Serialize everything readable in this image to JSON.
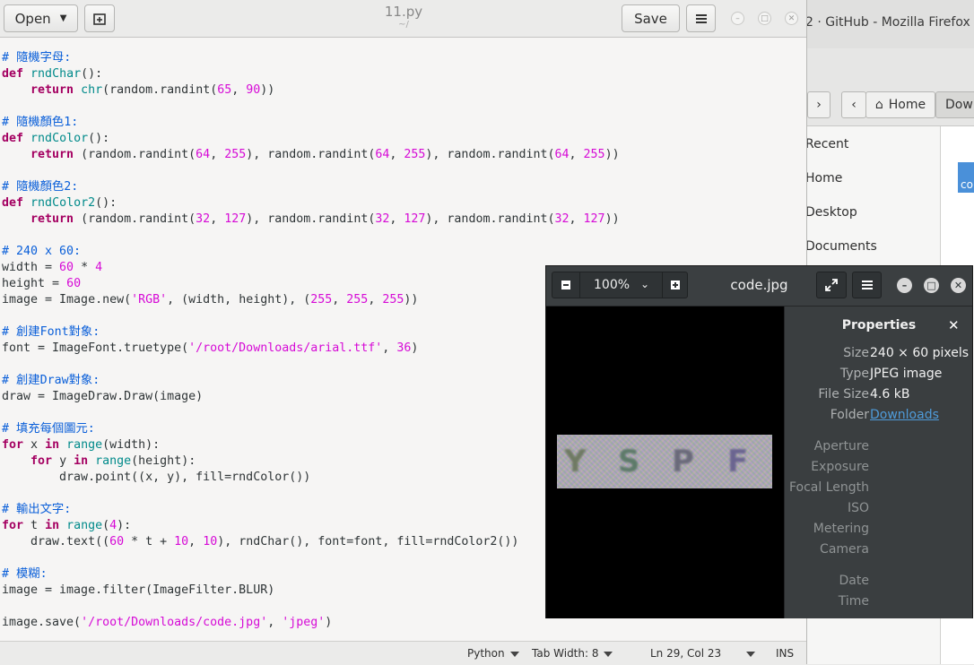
{
  "firefox": {
    "title": "2 · GitHub - Mozilla Firefox"
  },
  "files": {
    "nav_back": "‹",
    "nav_forward": "›",
    "home_label": "Home",
    "current_folder": "Dow",
    "sidebar": [
      "Recent",
      "Home",
      "Desktop",
      "Documents"
    ],
    "file_label": "co"
  },
  "gedit": {
    "open_label": "Open",
    "save_label": "Save",
    "title": "11.py",
    "path": "~/",
    "code": [
      [
        [
          "# 隨機字母:",
          "com"
        ]
      ],
      [
        [
          "def",
          "kw"
        ],
        [
          " ",
          ""
        ],
        [
          "rndChar",
          "fn"
        ],
        [
          "():",
          ""
        ]
      ],
      [
        [
          "    ",
          ""
        ],
        [
          "return",
          "kw"
        ],
        [
          " ",
          ""
        ],
        [
          "chr",
          "fn"
        ],
        [
          "(random.randint(",
          ""
        ],
        [
          "65",
          "num"
        ],
        [
          ", ",
          ""
        ],
        [
          "90",
          "num"
        ],
        [
          "))",
          ""
        ]
      ],
      [],
      [
        [
          "# 隨機顏色1:",
          "com"
        ]
      ],
      [
        [
          "def",
          "kw"
        ],
        [
          " ",
          ""
        ],
        [
          "rndColor",
          "fn"
        ],
        [
          "():",
          ""
        ]
      ],
      [
        [
          "    ",
          ""
        ],
        [
          "return",
          "kw"
        ],
        [
          " (random.randint(",
          ""
        ],
        [
          "64",
          "num"
        ],
        [
          ", ",
          ""
        ],
        [
          "255",
          "num"
        ],
        [
          "), random.randint(",
          ""
        ],
        [
          "64",
          "num"
        ],
        [
          ", ",
          ""
        ],
        [
          "255",
          "num"
        ],
        [
          "), random.randint(",
          ""
        ],
        [
          "64",
          "num"
        ],
        [
          ", ",
          ""
        ],
        [
          "255",
          "num"
        ],
        [
          "))",
          ""
        ]
      ],
      [],
      [
        [
          "# 隨機顏色2:",
          "com"
        ]
      ],
      [
        [
          "def",
          "kw"
        ],
        [
          " ",
          ""
        ],
        [
          "rndColor2",
          "fn"
        ],
        [
          "():",
          ""
        ]
      ],
      [
        [
          "    ",
          ""
        ],
        [
          "return",
          "kw"
        ],
        [
          " (random.randint(",
          ""
        ],
        [
          "32",
          "num"
        ],
        [
          ", ",
          ""
        ],
        [
          "127",
          "num"
        ],
        [
          "), random.randint(",
          ""
        ],
        [
          "32",
          "num"
        ],
        [
          ", ",
          ""
        ],
        [
          "127",
          "num"
        ],
        [
          "), random.randint(",
          ""
        ],
        [
          "32",
          "num"
        ],
        [
          ", ",
          ""
        ],
        [
          "127",
          "num"
        ],
        [
          "))",
          ""
        ]
      ],
      [],
      [
        [
          "# 240 x 60:",
          "com"
        ]
      ],
      [
        [
          "width = ",
          ""
        ],
        [
          "60",
          "num"
        ],
        [
          " * ",
          ""
        ],
        [
          "4",
          "num"
        ]
      ],
      [
        [
          "height = ",
          ""
        ],
        [
          "60",
          "num"
        ]
      ],
      [
        [
          "image = Image.new(",
          ""
        ],
        [
          "'RGB'",
          "str"
        ],
        [
          ", (width, height), (",
          ""
        ],
        [
          "255",
          "num"
        ],
        [
          ", ",
          ""
        ],
        [
          "255",
          "num"
        ],
        [
          ", ",
          ""
        ],
        [
          "255",
          "num"
        ],
        [
          "))",
          ""
        ]
      ],
      [],
      [
        [
          "# 創建Font對象:",
          "com"
        ]
      ],
      [
        [
          "font = ImageFont.truetype(",
          ""
        ],
        [
          "'/root/Downloads/arial.ttf'",
          "str"
        ],
        [
          ", ",
          ""
        ],
        [
          "36",
          "num"
        ],
        [
          ")",
          ""
        ]
      ],
      [],
      [
        [
          "# 創建Draw對象:",
          "com"
        ]
      ],
      [
        [
          "draw = ImageDraw.Draw(image)",
          ""
        ]
      ],
      [],
      [
        [
          "# 填充每個圖元:",
          "com"
        ]
      ],
      [
        [
          "for",
          "kw"
        ],
        [
          " x ",
          ""
        ],
        [
          "in",
          "kw"
        ],
        [
          " ",
          ""
        ],
        [
          "range",
          "fn"
        ],
        [
          "(width):",
          ""
        ]
      ],
      [
        [
          "    ",
          ""
        ],
        [
          "for",
          "kw"
        ],
        [
          " y ",
          ""
        ],
        [
          "in",
          "kw"
        ],
        [
          " ",
          ""
        ],
        [
          "range",
          "fn"
        ],
        [
          "(height):",
          ""
        ]
      ],
      [
        [
          "        draw.point((x, y), fill=rndColor())",
          ""
        ]
      ],
      [],
      [
        [
          "# 輸出文字:",
          "com"
        ]
      ],
      [
        [
          "for",
          "kw"
        ],
        [
          " t ",
          ""
        ],
        [
          "in",
          "kw"
        ],
        [
          " ",
          ""
        ],
        [
          "range",
          "fn"
        ],
        [
          "(",
          ""
        ],
        [
          "4",
          "num"
        ],
        [
          "):",
          ""
        ]
      ],
      [
        [
          "    draw.text((",
          ""
        ],
        [
          "60",
          "num"
        ],
        [
          " * t + ",
          ""
        ],
        [
          "10",
          "num"
        ],
        [
          ", ",
          ""
        ],
        [
          "10",
          "num"
        ],
        [
          "), rndChar(), font=font, fill=rndColor2())",
          ""
        ]
      ],
      [],
      [
        [
          "# 模糊:",
          "com"
        ]
      ],
      [
        [
          "image = image.filter(ImageFilter.BLUR)",
          ""
        ]
      ],
      [],
      [
        [
          "image.save(",
          ""
        ],
        [
          "'/root/Downloads/code.jpg'",
          "str"
        ],
        [
          ", ",
          ""
        ],
        [
          "'jpeg'",
          "str"
        ],
        [
          ")",
          ""
        ]
      ]
    ],
    "status": {
      "language": "Python",
      "tab_width": "Tab Width: 8",
      "position": "Ln 29, Col 23",
      "mode": "INS"
    }
  },
  "viewer": {
    "zoom": "100%",
    "title": "code.jpg",
    "captcha_letters": [
      "Y",
      "S",
      "P",
      "F"
    ],
    "captcha_colors": [
      "#6f7a63",
      "#5d7a69",
      "#6a6a7a",
      "#6a6490"
    ],
    "properties_title": "Properties",
    "properties": [
      {
        "key": "Size",
        "value": "240 × 60 pixels"
      },
      {
        "key": "Type",
        "value": "JPEG image"
      },
      {
        "key": "File Size",
        "value": "4.6 kB"
      },
      {
        "key": "Folder",
        "value": "Downloads"
      }
    ],
    "exif": [
      "Aperture",
      "Exposure",
      "Focal Length",
      "ISO",
      "Metering",
      "Camera"
    ],
    "datetime": [
      "Date",
      "Time"
    ]
  }
}
